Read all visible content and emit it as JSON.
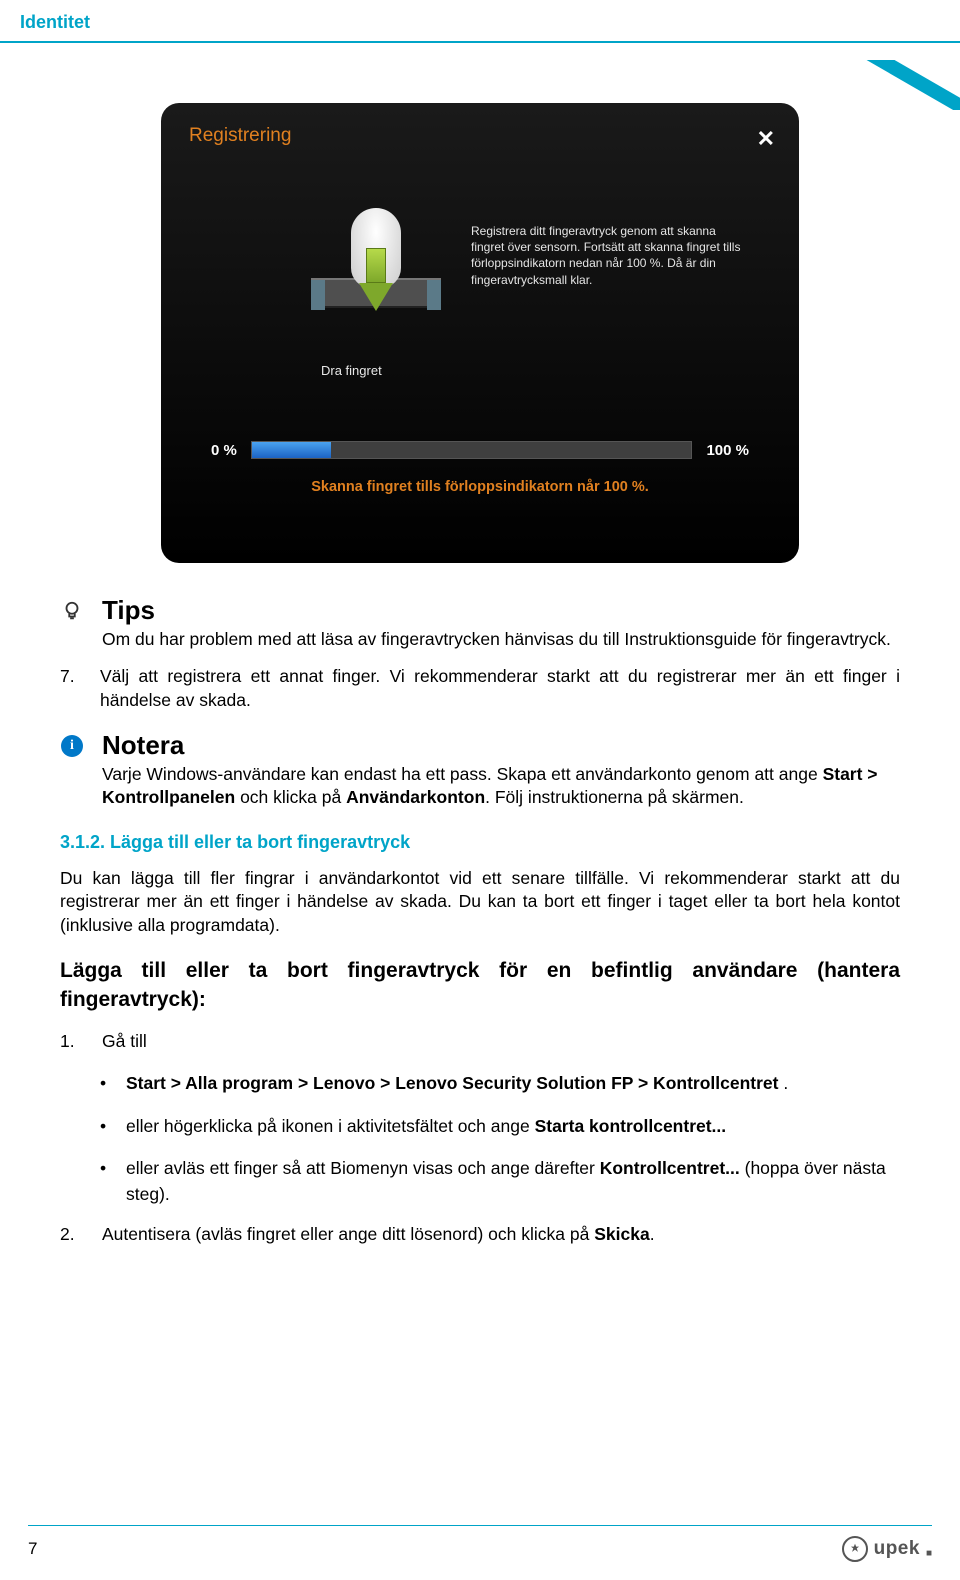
{
  "header": {
    "title": "Identitet"
  },
  "screenshot": {
    "title": "Registrering",
    "close": "✕",
    "instruction": "Registrera ditt fingeravtryck genom att skanna fingret över sensorn. Fortsätt att skanna fingret tills förloppsindikatorn nedan når 100 %. Då är din fingeravtrycksmall klar.",
    "drag_label": "Dra fingret",
    "pct_left": "0 %",
    "pct_right": "100 %",
    "caption": "Skanna fingret tills förloppsindikatorn når 100 %."
  },
  "tips": {
    "title": "Tips",
    "text": "Om du har problem med att läsa av fingeravtrycken hänvisas du till Instruktionsguide för fingeravtryck."
  },
  "step7": {
    "num": "7.",
    "text": "Välj att registrera ett annat finger. Vi rekommenderar starkt att du registrerar mer än ett finger i händelse av skada."
  },
  "note": {
    "title": "Notera",
    "text_pre": "Varje Windows-användare kan endast ha ett pass. Skapa ett användarkonto genom att ange ",
    "bold1": "Start > Kontrollpanelen",
    "mid1": " och klicka på ",
    "bold2": "Användarkonton",
    "suffix": ". Följ instruktionerna på skärmen."
  },
  "section": {
    "num": "3.1.2. Lägga till eller ta bort fingeravtryck"
  },
  "para1": "Du kan lägga till fler fingrar i användarkontot vid ett senare tillfälle. Vi rekommenderar starkt att du registrerar mer än ett finger i händelse av skada. Du kan ta bort ett finger i taget eller ta bort hela kontot (inklusive alla programdata).",
  "h3": "Lägga till eller ta bort fingeravtryck för en befintlig användare (hantera fingeravtryck):",
  "list1": {
    "num": "1.",
    "text": "Gå till"
  },
  "sub": {
    "a_pre": "Start > Alla program > Lenovo > Lenovo Security Solution FP > Kontrollcentret",
    "a_suf": " .",
    "b_pre": "eller högerklicka på ikonen i aktivitetsfältet och ange ",
    "b_bold": "Starta kontrollcentret...",
    "c_pre": "eller avläs ett finger så att Biomenyn visas och ange därefter ",
    "c_bold": "Kontrollcentret...",
    "c_suf": " (hoppa över nästa steg)."
  },
  "list2": {
    "num": "2.",
    "pre": "Autentisera (avläs fingret eller ange ditt lösenord) och klicka på ",
    "bold": "Skicka",
    "suf": "."
  },
  "footer": {
    "page": "7",
    "logo": "upek"
  }
}
